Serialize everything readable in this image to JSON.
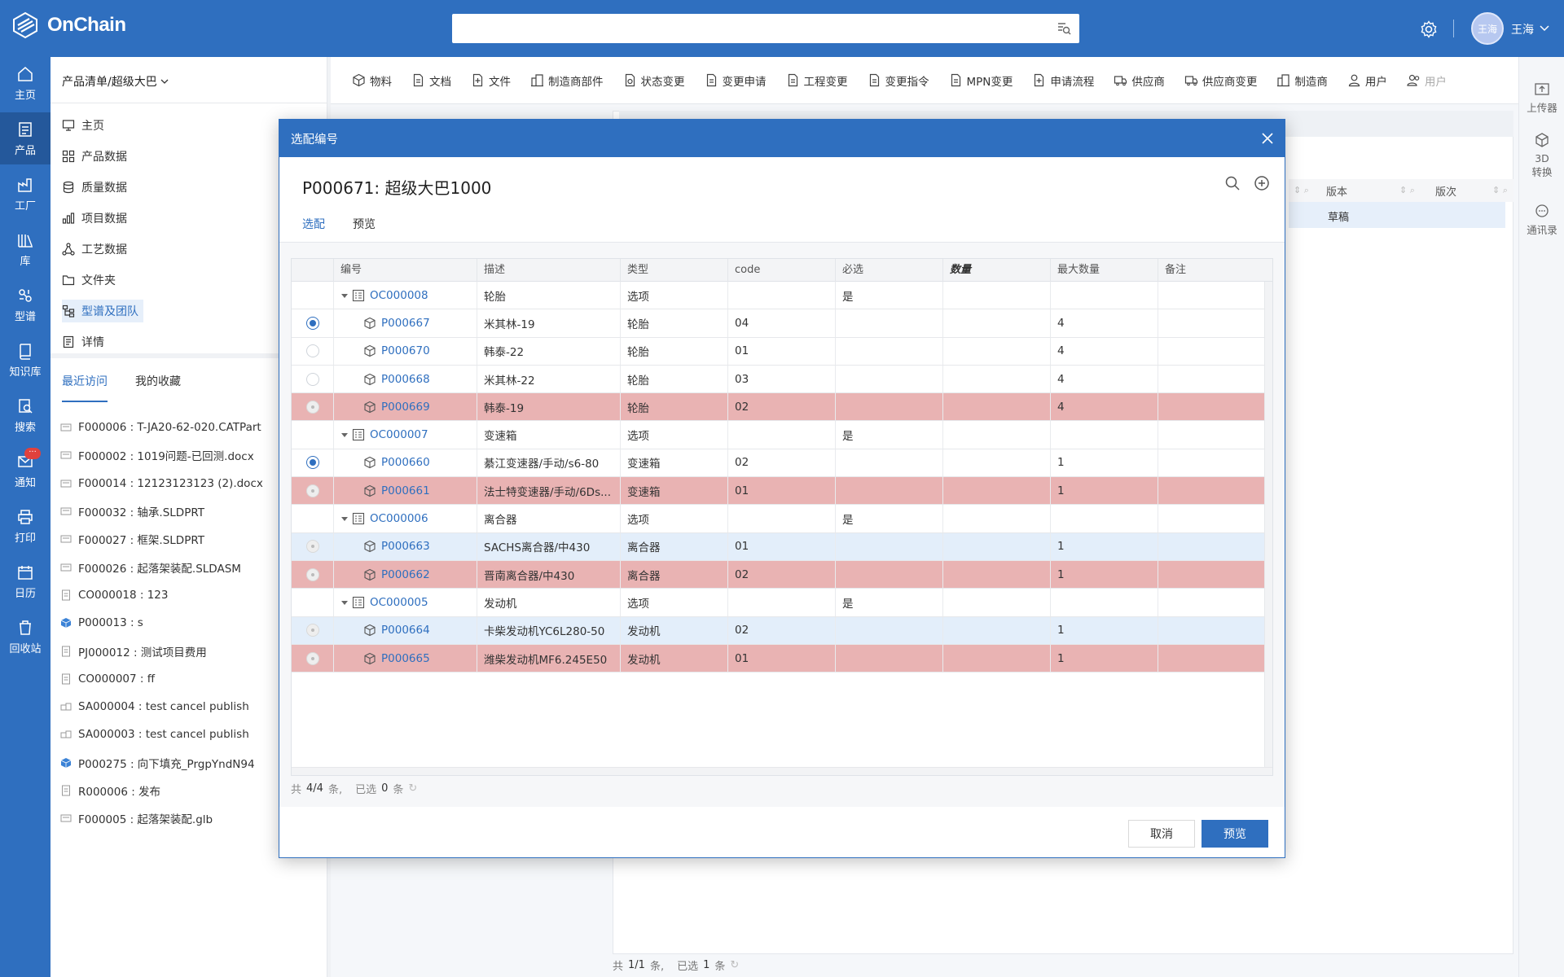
{
  "app": {
    "logo_text": "OnChain",
    "user_name": "王海",
    "avatar_text": "王海"
  },
  "leftnav": {
    "items": [
      {
        "label": "主页",
        "icon": "home-icon"
      },
      {
        "label": "产品",
        "icon": "product-icon"
      },
      {
        "label": "工厂",
        "icon": "factory-icon"
      },
      {
        "label": "库",
        "icon": "library-icon"
      },
      {
        "label": "型谱",
        "icon": "spectrum-icon"
      },
      {
        "label": "知识库",
        "icon": "book-icon"
      },
      {
        "label": "搜索",
        "icon": "search-icon"
      },
      {
        "label": "通知",
        "icon": "mail-icon",
        "badge": "···"
      },
      {
        "label": "打印",
        "icon": "printer-icon"
      },
      {
        "label": "日历",
        "icon": "calendar-icon"
      },
      {
        "label": "回收站",
        "icon": "trash-icon"
      }
    ]
  },
  "leftpanel": {
    "breadcrumb": "产品清单/超级大巴",
    "menu": [
      {
        "label": "主页",
        "icon": "monitor-icon"
      },
      {
        "label": "产品数据",
        "icon": "grid-icon"
      },
      {
        "label": "质量数据",
        "icon": "database-icon"
      },
      {
        "label": "项目数据",
        "icon": "bar-chart-icon"
      },
      {
        "label": "工艺数据",
        "icon": "nodes-icon"
      },
      {
        "label": "文件夹",
        "icon": "folder-icon"
      },
      {
        "label": "型谱及团队",
        "icon": "tree-icon"
      },
      {
        "label": "详情",
        "icon": "detail-icon"
      }
    ],
    "tabs": [
      "最近访问",
      "我的收藏"
    ],
    "recent": [
      {
        "text": "F000006 : T-JA20-62-020.CATPart",
        "icon": "file-cad-icon"
      },
      {
        "text": "F000002 : 1019问题-已回测.docx",
        "icon": "file-cad-icon"
      },
      {
        "text": "F000014 : 12123123123 (2).docx",
        "icon": "file-cad-icon"
      },
      {
        "text": "F000032 : 轴承.SLDPRT",
        "icon": "file-cad-icon"
      },
      {
        "text": "F000027 : 框架.SLDPRT",
        "icon": "file-cad-icon"
      },
      {
        "text": "F000026 : 起落架装配.SLDASM",
        "icon": "file-cad-icon"
      },
      {
        "text": "CO000018 :  123",
        "icon": "document-icon"
      },
      {
        "text": "P000013 :  s",
        "icon": "cube-blue-icon"
      },
      {
        "text": "PJ000012 :  测试项目费用",
        "icon": "document-icon"
      },
      {
        "text": "CO000007 :  ff",
        "icon": "document-icon"
      },
      {
        "text": "SA000004 :  test cancel publish",
        "icon": "assembly-icon"
      },
      {
        "text": "SA000003 :  test cancel publish",
        "icon": "assembly-icon"
      },
      {
        "text": "P000275 :  向下填充_PrgpYndN94",
        "icon": "cube-blue-icon"
      },
      {
        "text": "R000006 :  发布",
        "icon": "document-icon"
      },
      {
        "text": "F000005 : 起落架装配.glb",
        "icon": "file-cad-icon"
      }
    ]
  },
  "toolbar": {
    "items": [
      {
        "label": "物料",
        "icon": "cube-icon"
      },
      {
        "label": "文档",
        "icon": "doc-icon"
      },
      {
        "label": "文件",
        "icon": "file-icon"
      },
      {
        "label": "制造商部件",
        "icon": "building-icon"
      },
      {
        "label": "状态变更",
        "icon": "status-icon"
      },
      {
        "label": "变更申请",
        "icon": "doc-icon"
      },
      {
        "label": "工程变更",
        "icon": "doc-icon"
      },
      {
        "label": "变更指令",
        "icon": "doc-icon"
      },
      {
        "label": "MPN变更",
        "icon": "doc-icon"
      },
      {
        "label": "申请流程",
        "icon": "doc-icon"
      },
      {
        "label": "供应商",
        "icon": "truck-icon"
      },
      {
        "label": "供应商变更",
        "icon": "truck-icon"
      },
      {
        "label": "制造商",
        "icon": "building-icon"
      },
      {
        "label": "用户",
        "icon": "user-icon"
      },
      {
        "label": "用户",
        "icon": "users-icon"
      }
    ]
  },
  "rightstrip": {
    "items": [
      {
        "label": "上传器",
        "icon": "upload-icon"
      },
      {
        "label": "3D\n转换",
        "icon": "cube-3d-icon"
      },
      {
        "label": "通讯录",
        "icon": "chat-icon"
      }
    ]
  },
  "background": {
    "col_version": "版本",
    "col_revision": "版次",
    "row_status": "草稿",
    "footer_total": "共",
    "footer_total_val": "1/1",
    "footer_total_unit": "条,",
    "footer_sel": "已选",
    "footer_sel_val": "1",
    "footer_sel_unit": "条"
  },
  "modal": {
    "header": "选配编号",
    "title": "P000671:  超级大巴1000",
    "tabs": [
      "选配",
      "预览"
    ],
    "columns": [
      "编号",
      "描述",
      "类型",
      "code",
      "必选",
      "数量",
      "最大数量",
      "备注"
    ],
    "rows": [
      {
        "kind": "group",
        "code": "OC000008",
        "desc": "轮胎",
        "type": "选项",
        "cd": "",
        "req": "是",
        "qty": "",
        "max": ""
      },
      {
        "kind": "item",
        "radio": "on",
        "code": "P000667",
        "desc": "米其林-19",
        "type": "轮胎",
        "cd": "04",
        "req": "",
        "qty": "",
        "max": "4",
        "tone": ""
      },
      {
        "kind": "item",
        "radio": "off",
        "code": "P000670",
        "desc": "韩泰-22",
        "type": "轮胎",
        "cd": "01",
        "req": "",
        "qty": "",
        "max": "4",
        "tone": ""
      },
      {
        "kind": "item",
        "radio": "off",
        "code": "P000668",
        "desc": "米其林-22",
        "type": "轮胎",
        "cd": "03",
        "req": "",
        "qty": "",
        "max": "4",
        "tone": ""
      },
      {
        "kind": "item",
        "radio": "dim",
        "code": "P000669",
        "desc": "韩泰-19",
        "type": "轮胎",
        "cd": "02",
        "req": "",
        "qty": "",
        "max": "4",
        "tone": "red"
      },
      {
        "kind": "group",
        "code": "OC000007",
        "desc": "变速箱",
        "type": "选项",
        "cd": "",
        "req": "是",
        "qty": "",
        "max": ""
      },
      {
        "kind": "item",
        "radio": "on",
        "code": "P000660",
        "desc": "綦江变速器/手动/s6-80",
        "type": "变速箱",
        "cd": "02",
        "req": "",
        "qty": "",
        "max": "1",
        "tone": ""
      },
      {
        "kind": "item",
        "radio": "dim",
        "code": "P000661",
        "desc": "法士特变速器/手动/6Ds...",
        "type": "变速箱",
        "cd": "01",
        "req": "",
        "qty": "",
        "max": "1",
        "tone": "red"
      },
      {
        "kind": "group",
        "code": "OC000006",
        "desc": "离合器",
        "type": "选项",
        "cd": "",
        "req": "是",
        "qty": "",
        "max": ""
      },
      {
        "kind": "item",
        "radio": "dim",
        "code": "P000663",
        "desc": "SACHS离合器/中430",
        "type": "离合器",
        "cd": "01",
        "req": "",
        "qty": "",
        "max": "1",
        "tone": "blue"
      },
      {
        "kind": "item",
        "radio": "dim",
        "code": "P000662",
        "desc": "晋南离合器/中430",
        "type": "离合器",
        "cd": "02",
        "req": "",
        "qty": "",
        "max": "1",
        "tone": "red"
      },
      {
        "kind": "group",
        "code": "OC000005",
        "desc": "发动机",
        "type": "选项",
        "cd": "",
        "req": "是",
        "qty": "",
        "max": ""
      },
      {
        "kind": "item",
        "radio": "dim",
        "code": "P000664",
        "desc": "卡柴发动机YC6L280-50",
        "type": "发动机",
        "cd": "02",
        "req": "",
        "qty": "",
        "max": "1",
        "tone": "blue"
      },
      {
        "kind": "item",
        "radio": "dim",
        "code": "P000665",
        "desc": "潍柴发动机MF6.245E50",
        "type": "发动机",
        "cd": "01",
        "req": "",
        "qty": "",
        "max": "1",
        "tone": "red"
      }
    ],
    "footer_total": "共",
    "footer_total_val": "4/4",
    "footer_total_unit": "条,",
    "footer_sel": "已选",
    "footer_sel_val": "0",
    "footer_sel_unit": "条",
    "cancel_label": "取消",
    "preview_label": "预览"
  },
  "colors": {
    "primary": "#2f6fbf",
    "row_red": "#e9b3b3",
    "row_blue": "#e3eefa"
  }
}
